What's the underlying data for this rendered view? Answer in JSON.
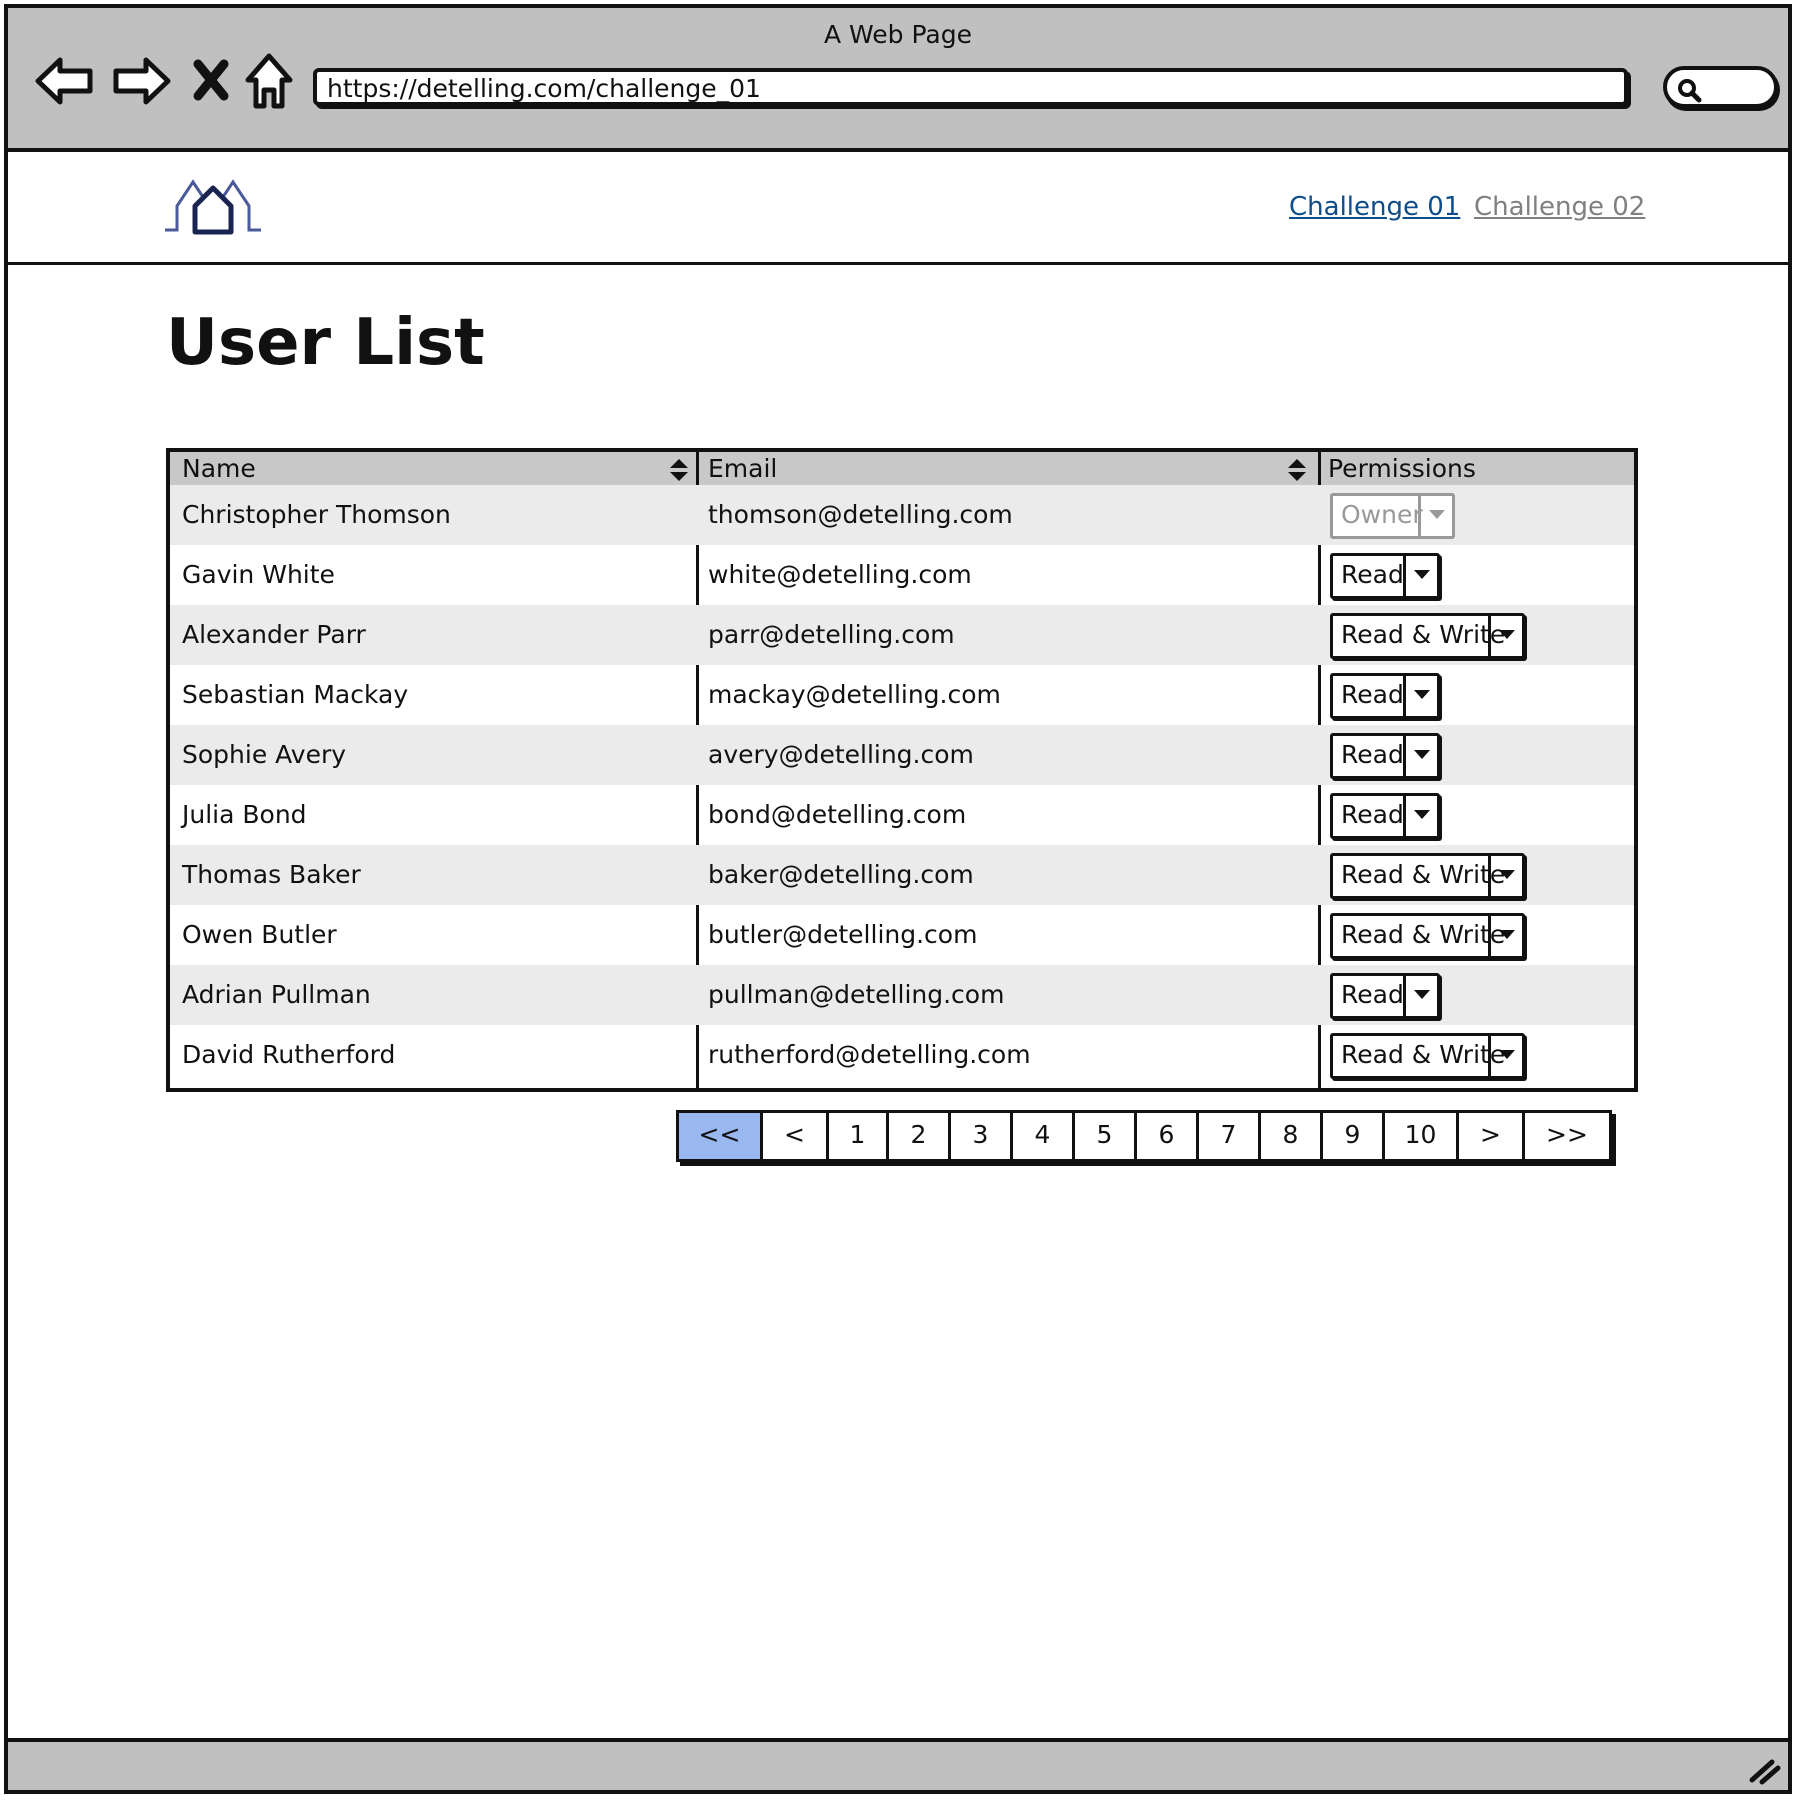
{
  "browser": {
    "window_title": "A Web Page",
    "url": "https://detelling.com/challenge_01"
  },
  "header": {
    "nav": [
      {
        "label": "Challenge 01",
        "active": true
      },
      {
        "label": "Challenge 02",
        "active": false
      }
    ]
  },
  "main": {
    "title": "User List",
    "table": {
      "columns": [
        "Name",
        "Email",
        "Permissions"
      ],
      "rows": [
        {
          "name": "Christopher Thomson",
          "email": "thomson@detelling.com",
          "permission": "Owner",
          "disabled": true
        },
        {
          "name": "Gavin White",
          "email": "white@detelling.com",
          "permission": "Read"
        },
        {
          "name": "Alexander Parr",
          "email": "parr@detelling.com",
          "permission": "Read & Write"
        },
        {
          "name": "Sebastian Mackay",
          "email": "mackay@detelling.com",
          "permission": "Read"
        },
        {
          "name": "Sophie Avery",
          "email": "avery@detelling.com",
          "permission": "Read"
        },
        {
          "name": "Julia Bond",
          "email": "bond@detelling.com",
          "permission": "Read"
        },
        {
          "name": "Thomas Baker",
          "email": "baker@detelling.com",
          "permission": "Read & Write"
        },
        {
          "name": "Owen Butler",
          "email": "butler@detelling.com",
          "permission": "Read & Write"
        },
        {
          "name": "Adrian Pullman",
          "email": "pullman@detelling.com",
          "permission": "Read"
        },
        {
          "name": "David Rutherford",
          "email": "rutherford@detelling.com",
          "permission": "Read & Write"
        }
      ]
    },
    "pagination": [
      "<<",
      "<",
      "1",
      "2",
      "3",
      "4",
      "5",
      "6",
      "7",
      "8",
      "9",
      "10",
      ">",
      ">>"
    ],
    "pagination_current": "<<"
  },
  "colors": {
    "chrome": "#c0c0c0",
    "link_active": "#0f4d8a",
    "link_inactive": "#808080",
    "row_shade": "#ebebeb",
    "pager_current": "#99b8f0",
    "logo": "#2a3a7a"
  },
  "icons": [
    "back-arrow-icon",
    "forward-arrow-icon",
    "close-icon",
    "home-icon",
    "search-icon",
    "logo-house-icon",
    "sort-icon",
    "chevron-down-icon",
    "resize-grip-icon"
  ]
}
